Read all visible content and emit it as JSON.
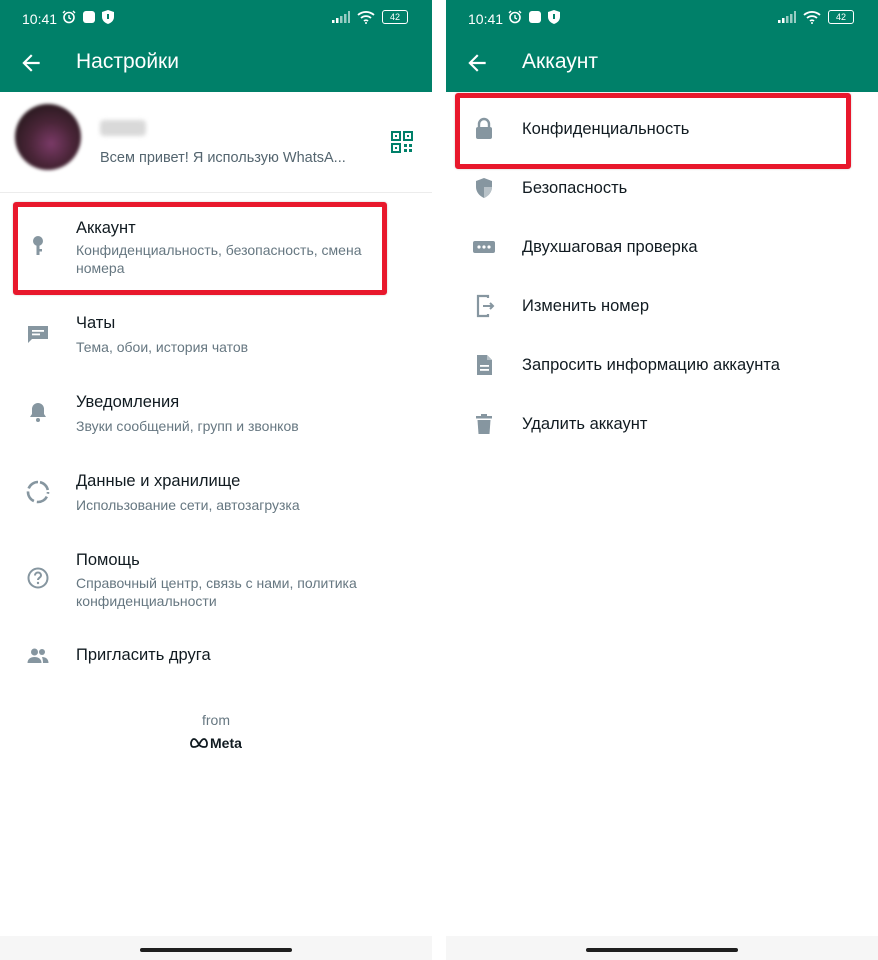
{
  "left_screen": {
    "status": {
      "time": "10:41",
      "battery": "42"
    },
    "title": "Настройки",
    "profile": {
      "status": "Всем привет! Я использую WhatsA..."
    },
    "items": [
      {
        "title": "Аккаунт",
        "subtitle": "Конфиденциальность, безопасность, смена номера",
        "icon": "key-icon",
        "highlighted": true
      },
      {
        "title": "Чаты",
        "subtitle": "Тема, обои, история чатов",
        "icon": "chat-icon"
      },
      {
        "title": "Уведомления",
        "subtitle": "Звуки сообщений, групп и звонков",
        "icon": "bell-icon"
      },
      {
        "title": "Данные и хранилище",
        "subtitle": "Использование сети, автозагрузка",
        "icon": "storage-icon"
      },
      {
        "title": "Помощь",
        "subtitle": "Справочный центр, связь с нами, политика конфиденциальности",
        "icon": "help-icon"
      },
      {
        "title": "Пригласить друга",
        "subtitle": "",
        "icon": "people-icon"
      }
    ],
    "footer": {
      "from": "from",
      "brand": "Meta"
    }
  },
  "right_screen": {
    "status": {
      "time": "10:41",
      "battery": "42"
    },
    "title": "Аккаунт",
    "items": [
      {
        "title": "Конфиденциальность",
        "icon": "lock-icon",
        "highlighted": true
      },
      {
        "title": "Безопасность",
        "icon": "shield-icon"
      },
      {
        "title": "Двухшаговая проверка",
        "icon": "dots-icon"
      },
      {
        "title": "Изменить номер",
        "icon": "change-number-icon"
      },
      {
        "title": "Запросить информацию аккаунта",
        "icon": "document-icon"
      },
      {
        "title": "Удалить аккаунт",
        "icon": "trash-icon"
      }
    ]
  },
  "colors": {
    "appbar": "#008069",
    "highlight": "#e8182c",
    "icon_gray": "#8696a0",
    "accent": "#008069"
  }
}
